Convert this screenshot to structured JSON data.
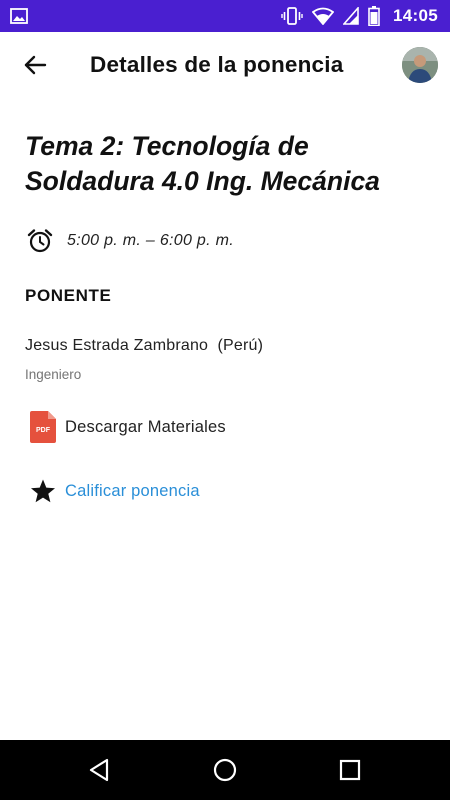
{
  "status_bar": {
    "time": "14:05",
    "icons": [
      "gallery-icon",
      "vibrate-icon",
      "wifi-icon",
      "signal-icon",
      "battery-icon"
    ],
    "background": "#4a1fd0"
  },
  "app_bar": {
    "title": "Detalles de la ponencia",
    "back_icon": "arrow-left-icon",
    "avatar": "user-avatar"
  },
  "talk": {
    "title": "Tema 2:  Tecnología de Soldadura 4.0  Ing. Mecánica",
    "schedule": "5:00 p. m. – 6:00 p. m.",
    "schedule_icon": "alarm-clock-icon"
  },
  "speaker_section": {
    "heading": "PONENTE",
    "name": "Jesus Estrada Zambrano  (Perú)",
    "role": "Ingeniero"
  },
  "actions": {
    "download": {
      "label": "Descargar Materiales",
      "icon": "pdf-file-icon",
      "icon_text": "PDF",
      "icon_color": "#e5513d"
    },
    "rate": {
      "label": "Calificar ponencia",
      "icon": "star-icon",
      "color": "#2a8fd8"
    }
  },
  "nav_bar": {
    "buttons": [
      "back-triangle-icon",
      "home-circle-icon",
      "recents-square-icon"
    ]
  }
}
